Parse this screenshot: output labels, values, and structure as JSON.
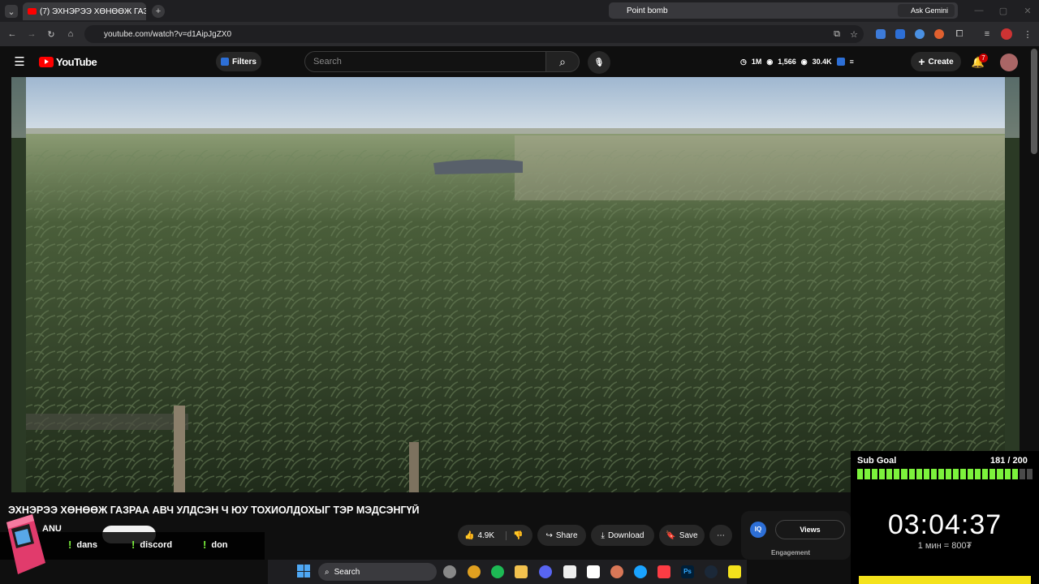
{
  "browser": {
    "tab_title": "(7) ЭХНЭРЭЭ ХӨНӨӨЖ ГАЗ",
    "url": "youtube.com/watch?v=d1AipJgZX0",
    "window_title": "Point bomb",
    "ask_gemini": "Ask Gemini"
  },
  "youtube": {
    "logo_text": "YouTube",
    "filters_label": "Filters",
    "search_placeholder": "Search",
    "stat_1": "1M",
    "stat_2": "1,566",
    "stat_3": "30.4K",
    "create_label": "Create",
    "notification_count": "7"
  },
  "video": {
    "title": "ЭХНЭРЭЭ ХӨНӨӨЖ ГАЗРАА АВЧ УЛДСЭН Ч ЮУ ТОХИОЛДОХЫГ ТЭР МЭДСЭНГҮЙ",
    "channel_fragment": "ANU",
    "likes": "4.9K",
    "share_label": "Share",
    "download_label": "Download",
    "save_label": "Save"
  },
  "side_panel": {
    "views_label": "Views",
    "engagement_label": "Engagement"
  },
  "overlay": {
    "chat_items": [
      "dans",
      "discord",
      "don"
    ],
    "sub_goal_label": "Sub Goal",
    "sub_goal_value": "181 / 200",
    "sub_goal_progress": 0.9,
    "timer": "03:04:37",
    "rate": "1 мин = 800₮",
    "accent": "#7cf23c"
  },
  "taskbar": {
    "search_label": "Search"
  }
}
